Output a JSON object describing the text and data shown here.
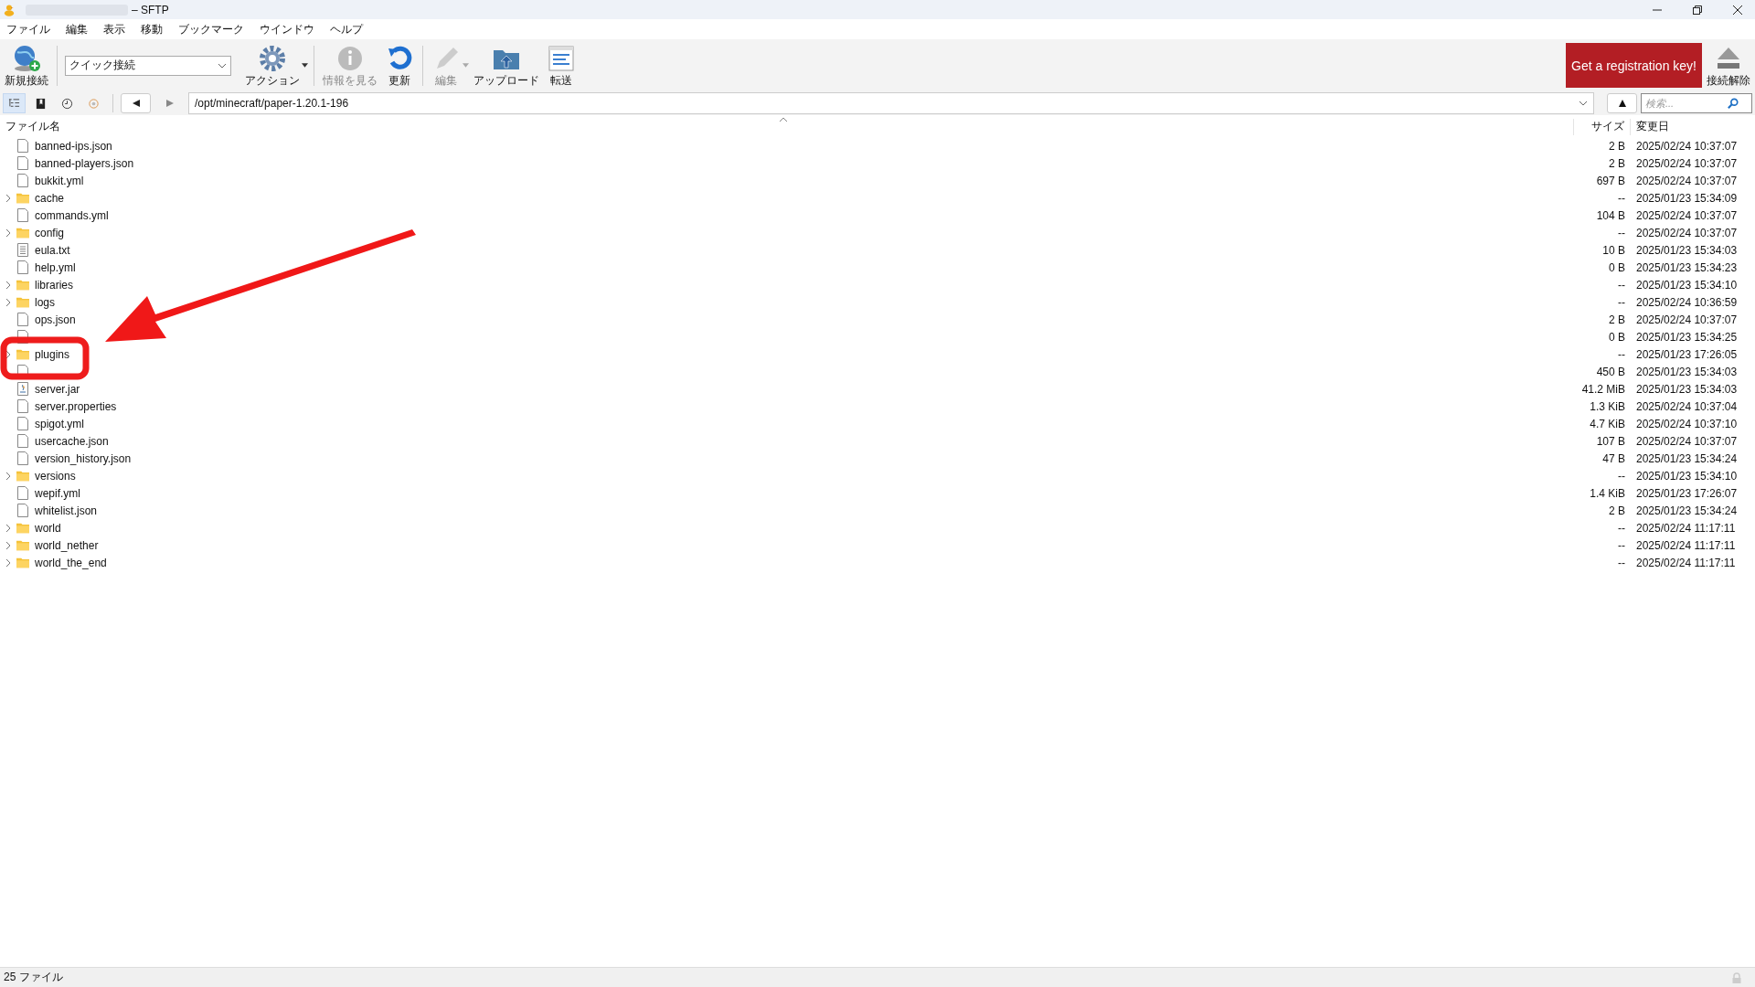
{
  "window": {
    "title": "– SFTP"
  },
  "menu": [
    "ファイル",
    "編集",
    "表示",
    "移動",
    "ブックマーク",
    "ウインドウ",
    "ヘルプ"
  ],
  "toolbar": {
    "items": [
      {
        "kind": "globe",
        "label": "新規接続",
        "disabled": false
      },
      {
        "kind": "combo",
        "value": "クイック接続"
      },
      {
        "kind": "gear",
        "label": "アクション",
        "disabled": false
      },
      {
        "kind": "info",
        "label": "情報を見る",
        "disabled": true
      },
      {
        "kind": "refresh",
        "label": "更新",
        "disabled": false
      },
      {
        "kind": "pencil",
        "label": "編集",
        "disabled": true
      },
      {
        "kind": "upload",
        "label": "アップロード",
        "disabled": false
      },
      {
        "kind": "transfer",
        "label": "転送",
        "disabled": false
      }
    ],
    "register": "Get a registration key!",
    "disconnect": "接続解除"
  },
  "nav": {
    "views": [
      {
        "kind": "browser",
        "selected": true
      },
      {
        "kind": "bookmarks",
        "selected": false
      },
      {
        "kind": "history",
        "selected": false
      },
      {
        "kind": "bonjour",
        "selected": false
      }
    ],
    "path": "/opt/minecraft/paper-1.20.1-196",
    "search": {
      "placeholder": "検索..."
    }
  },
  "table": {
    "columns": [
      "ファイル名",
      "サイズ",
      "変更日"
    ],
    "rows": [
      {
        "kind": "file",
        "name": "banned-ips.json",
        "size": "2 B",
        "modified": "2025/02/24 10:37:07"
      },
      {
        "kind": "file",
        "name": "banned-players.json",
        "size": "2 B",
        "modified": "2025/02/24 10:37:07"
      },
      {
        "kind": "file",
        "name": "bukkit.yml",
        "size": "697 B",
        "modified": "2025/02/24 10:37:07"
      },
      {
        "kind": "folder",
        "name": "cache",
        "size": "--",
        "modified": "2025/01/23 15:34:09"
      },
      {
        "kind": "file",
        "name": "commands.yml",
        "size": "104 B",
        "modified": "2025/02/24 10:37:07"
      },
      {
        "kind": "folder",
        "name": "config",
        "size": "--",
        "modified": "2025/02/24 10:37:07"
      },
      {
        "kind": "text",
        "name": "eula.txt",
        "size": "10 B",
        "modified": "2025/01/23 15:34:03"
      },
      {
        "kind": "file",
        "name": "help.yml",
        "size": "0 B",
        "modified": "2025/01/23 15:34:23"
      },
      {
        "kind": "folder",
        "name": "libraries",
        "size": "--",
        "modified": "2025/01/23 15:34:10"
      },
      {
        "kind": "folder",
        "name": "logs",
        "size": "--",
        "modified": "2025/02/24 10:36:59"
      },
      {
        "kind": "file",
        "name": "ops.json",
        "size": "2 B",
        "modified": "2025/02/24 10:37:07"
      },
      {
        "kind": "file",
        "size": "0 B",
        "modified": "2025/01/23 15:34:25"
      },
      {
        "kind": "folder",
        "name": "plugins",
        "size": "--",
        "modified": "2025/01/23 17:26:05"
      },
      {
        "kind": "file",
        "size": "450 B",
        "modified": "2025/01/23 15:34:03"
      },
      {
        "kind": "jar",
        "name": "server.jar",
        "size": "41.2 MiB",
        "modified": "2025/01/23 15:34:03"
      },
      {
        "kind": "file",
        "name": "server.properties",
        "size": "1.3 KiB",
        "modified": "2025/02/24 10:37:04"
      },
      {
        "kind": "file",
        "name": "spigot.yml",
        "size": "4.7 KiB",
        "modified": "2025/02/24 10:37:10"
      },
      {
        "kind": "file",
        "name": "usercache.json",
        "size": "107 B",
        "modified": "2025/02/24 10:37:07"
      },
      {
        "kind": "file",
        "name": "version_history.json",
        "size": "47 B",
        "modified": "2025/01/23 15:34:24"
      },
      {
        "kind": "folder",
        "name": "versions",
        "size": "--",
        "modified": "2025/01/23 15:34:10"
      },
      {
        "kind": "file",
        "name": "wepif.yml",
        "size": "1.4 KiB",
        "modified": "2025/01/23 17:26:07"
      },
      {
        "kind": "file",
        "name": "whitelist.json",
        "size": "2 B",
        "modified": "2025/01/23 15:34:24"
      },
      {
        "kind": "folder",
        "name": "world",
        "size": "--",
        "modified": "2025/02/24 11:17:11"
      },
      {
        "kind": "folder",
        "name": "world_nether",
        "size": "--",
        "modified": "2025/02/24 11:17:11"
      },
      {
        "kind": "folder",
        "name": "world_the_end",
        "size": "--",
        "modified": "2025/02/24 11:17:11"
      }
    ]
  },
  "status_bar": {
    "text": "25 ファイル"
  }
}
